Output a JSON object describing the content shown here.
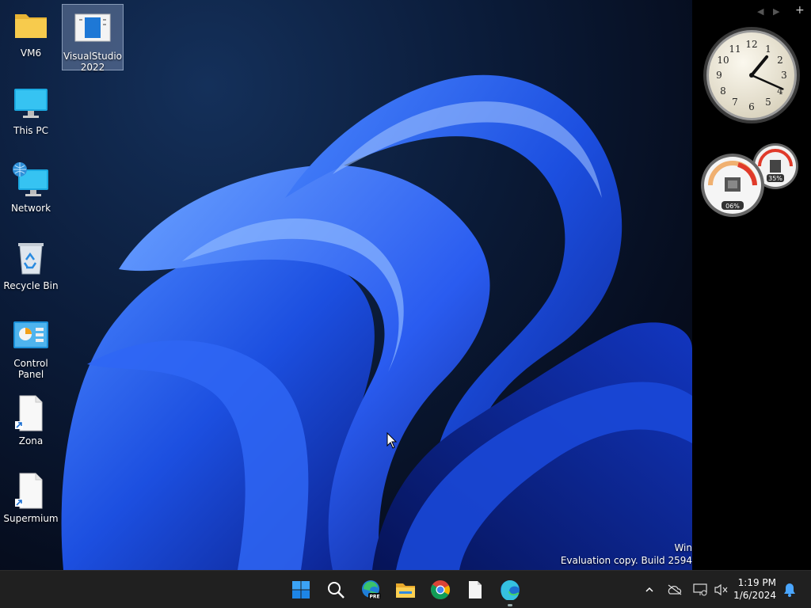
{
  "desktop_icons": [
    {
      "label": "VM6",
      "icon": "folder-icon"
    },
    {
      "label": "VisualStudio2022",
      "icon": "document-icon",
      "selected": true
    },
    {
      "label": "This PC",
      "icon": "monitor-icon"
    },
    {
      "label": "Network",
      "icon": "network-icon"
    },
    {
      "label": "Recycle Bin",
      "icon": "recycle-bin-icon"
    },
    {
      "label": "Control Panel",
      "icon": "control-panel-icon"
    },
    {
      "label": "Zona",
      "icon": "shortcut-file-icon"
    },
    {
      "label": "Supermium",
      "icon": "shortcut-file-icon"
    }
  ],
  "sidebar": {
    "controls": [
      "◀",
      "▶",
      "+"
    ],
    "clock": {
      "hour": 1,
      "minute": 19
    },
    "meter": {
      "cpu_label": "06%",
      "memory_label": "35%",
      "cpu_level": 0.06,
      "memory_level": 0.35
    }
  },
  "watermark": {
    "line1": "Win",
    "line2": "Evaluation copy. Build 2594"
  },
  "taskbar": {
    "apps": [
      "start-icon",
      "search-icon",
      "edge-preview-icon",
      "file-explorer-icon",
      "chrome-icon",
      "file-icon",
      "edge-icon"
    ],
    "edge_preview_badge": "PRE",
    "time": "1:19 PM",
    "date": "1/6/2024"
  },
  "colors": {
    "taskbar": "#202020",
    "accent": "#1a6fff",
    "desktop_dark": "#060d1e"
  }
}
